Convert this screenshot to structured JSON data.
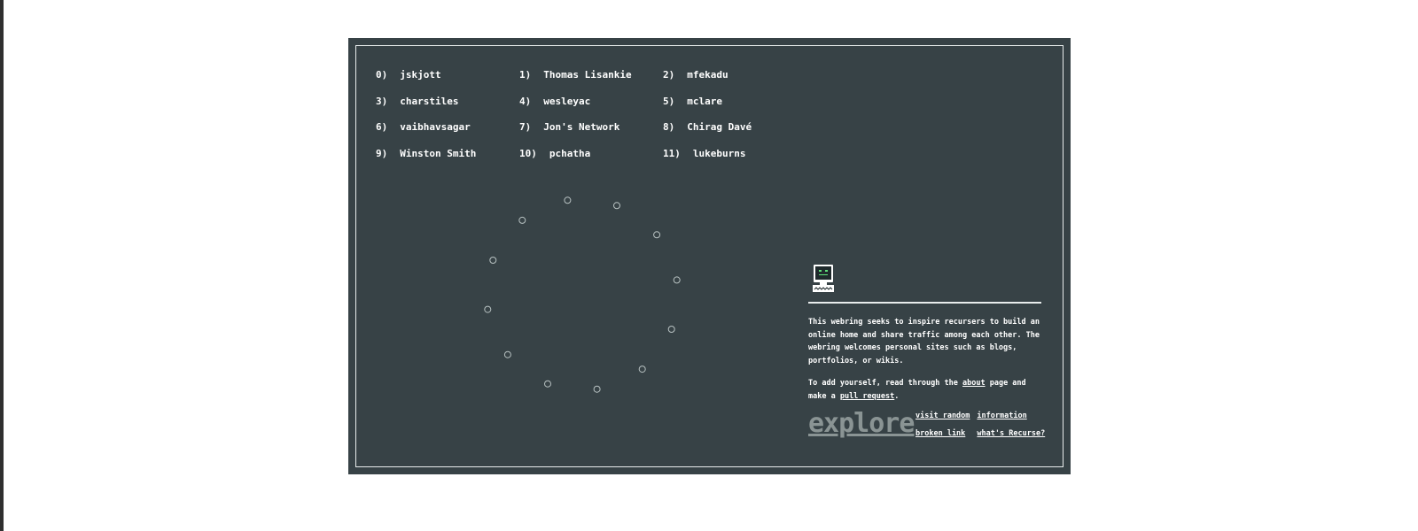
{
  "webring": {
    "members": [
      {
        "number": "0)",
        "name": "jskjott"
      },
      {
        "number": "1)",
        "name": "Thomas Lisankie"
      },
      {
        "number": "2)",
        "name": "mfekadu"
      },
      {
        "number": "3)",
        "name": "charstiles"
      },
      {
        "number": "4)",
        "name": "wesleyac"
      },
      {
        "number": "5)",
        "name": "mclare"
      },
      {
        "number": "6)",
        "name": "vaibhavsagar"
      },
      {
        "number": "7)",
        "name": "Jon's Network"
      },
      {
        "number": "8)",
        "name": "Chirag Davé"
      },
      {
        "number": "9)",
        "name": "Winston Smith"
      },
      {
        "number": "10)",
        "name": "pchatha"
      },
      {
        "number": "11)",
        "name": "lukeburns"
      }
    ],
    "ring_color": "#b8c2c2"
  },
  "about": {
    "icon": "computer-icon",
    "intro": "This webring seeks to inspire recursers to build an online home and share traffic among each other. The webring welcomes personal sites such as blogs, portfolios, or wikis.",
    "add_prefix": "To add yourself, read through the ",
    "about_link": "about",
    "add_middle": " page and make a ",
    "pull_request_link": "pull request",
    "add_suffix": "."
  },
  "footer": {
    "explore_label": "explore",
    "links": [
      "visit random",
      "information",
      "broken link",
      "what's Recurse?"
    ]
  },
  "colors": {
    "panel": "#374246",
    "frame": "#e8ecec",
    "text": "#ffffff",
    "explore": "#8a9494"
  }
}
